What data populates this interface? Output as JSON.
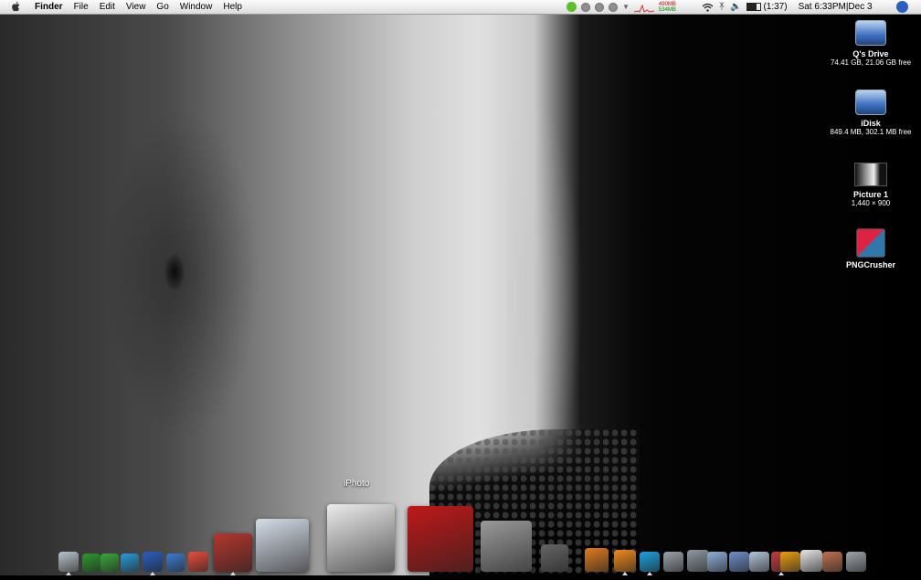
{
  "menubar": {
    "apple_icon": "apple-logo-icon",
    "app_name": "Finder",
    "menus": [
      "File",
      "Edit",
      "View",
      "Go",
      "Window",
      "Help"
    ],
    "memory_used": "490MB",
    "memory_free": "534MB",
    "battery_time": "(1:37)",
    "clock": "Sat 6:33PM|Dec 3",
    "icons": [
      "adium-icon",
      "itunes-prev-icon",
      "itunes-play-icon",
      "itunes-next-icon",
      "itunes-menu-icon",
      "activity-graph-icon",
      "wifi-icon",
      "bluetooth-icon",
      "volume-icon",
      "battery-icon",
      "spotlight-icon"
    ]
  },
  "desktop": {
    "icons": [
      {
        "name": "Q's Drive",
        "sub": "74.41 GB, 21.06 GB free",
        "icon": "hard-drive-icon"
      },
      {
        "name": "iDisk",
        "sub": "849.4 MB, 302.1 MB free",
        "icon": "idisk-icon"
      },
      {
        "name": "Picture 1",
        "sub": "1,440 × 900",
        "icon": "image-thumbnail-icon"
      },
      {
        "name": "PNGCrusher",
        "sub": "",
        "icon": "application-icon"
      }
    ]
  },
  "dock": {
    "hover_label": "iPhoto",
    "items": [
      {
        "icon": "finder-icon",
        "color": "#b8c4cc",
        "running": true
      },
      {
        "icon": "dashcode-icon",
        "color": "#2d9a2d",
        "running": false
      },
      {
        "icon": "dreamweaver-icon",
        "color": "#3aa83a",
        "running": false
      },
      {
        "icon": "flash-icon",
        "color": "#2b9ad8",
        "running": false
      },
      {
        "icon": "firefox-icon",
        "color": "#2a5fbf",
        "running": true
      },
      {
        "icon": "safari-icon",
        "color": "#3d7cd1",
        "running": false
      },
      {
        "icon": "ical-icon",
        "color": "#e84c3c",
        "running": false
      },
      {
        "icon": "mail-icon",
        "color": "#b3362e",
        "running": true
      },
      {
        "icon": "itunes-icon",
        "color": "#d5dde8",
        "running": false
      },
      {
        "icon": "iphoto-icon",
        "color": "#ececec",
        "running": false
      },
      {
        "icon": "imovie-icon",
        "color": "#c01818",
        "running": false
      },
      {
        "icon": "dvd-studio-icon",
        "color": "#9a9a9a",
        "running": false
      },
      {
        "icon": "final-cut-icon",
        "color": "#666666",
        "running": false
      },
      {
        "icon": "garageband-icon",
        "color": "#e07a1e",
        "running": false
      },
      {
        "icon": "burn-icon",
        "color": "#f08a1c",
        "running": true
      },
      {
        "icon": "skype-icon",
        "color": "#1aa3e0",
        "running": true
      },
      {
        "icon": "system-prefs-icon",
        "color": "#9ba3ab",
        "running": false
      },
      {
        "icon": "terminal-icon",
        "color": "#8f99a3",
        "running": false
      },
      {
        "icon": "textedit-icon",
        "color": "#8fb0d8",
        "running": false
      },
      {
        "icon": "preview-icon",
        "color": "#6d90c7",
        "running": false
      },
      {
        "icon": "quicktime-icon",
        "color": "#b4c6d8",
        "running": false
      },
      {
        "icon": "activity-icon",
        "color": "#c43c3c",
        "running": true
      },
      {
        "icon": "vlc-icon",
        "color": "#e8a012",
        "running": false
      },
      {
        "icon": "adium-duck-icon",
        "color": "#e6e6e6",
        "running": false
      },
      {
        "icon": "downloads-icon",
        "color": "#c07050",
        "running": false
      },
      {
        "icon": "trash-icon",
        "color": "#9ea4aa",
        "running": false
      }
    ]
  }
}
